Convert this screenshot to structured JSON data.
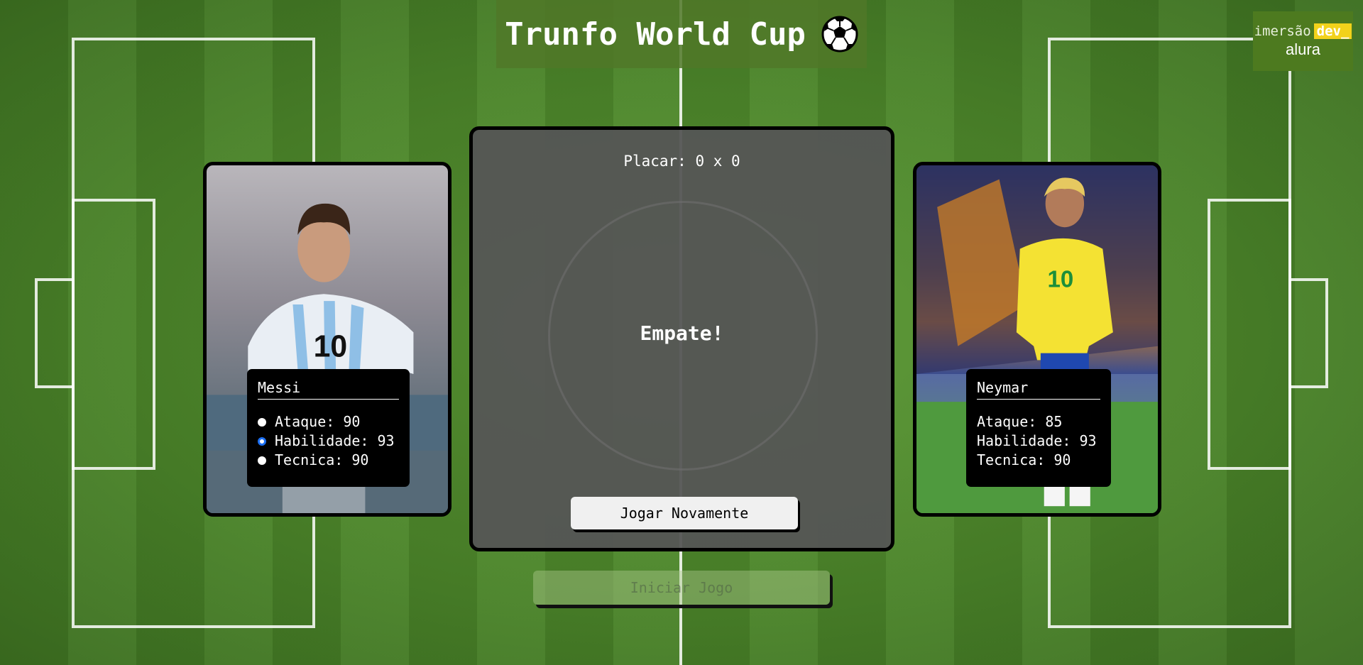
{
  "header": {
    "title": "Trunfo World Cup",
    "ball_icon": "soccer-ball-icon"
  },
  "logo": {
    "prefix": "imersão",
    "badge": "dev_",
    "brand": "alura",
    "badge_color": "#f2d21b"
  },
  "player_card": {
    "name": "Messi",
    "stats": [
      {
        "label": "Ataque: 90",
        "selected": false
      },
      {
        "label": "Habilidade: 93",
        "selected": true
      },
      {
        "label": "Tecnica: 90",
        "selected": false
      }
    ]
  },
  "machine_card": {
    "name": "Neymar",
    "stats": [
      {
        "label": "Ataque: 85"
      },
      {
        "label": "Habilidade: 93"
      },
      {
        "label": "Tecnica: 90"
      }
    ]
  },
  "board": {
    "score": "Placar: 0 x 0",
    "result": "Empate!",
    "play_again_label": "Jogar Novamente"
  },
  "start_button": {
    "label": "Iniciar Jogo",
    "disabled": true
  }
}
